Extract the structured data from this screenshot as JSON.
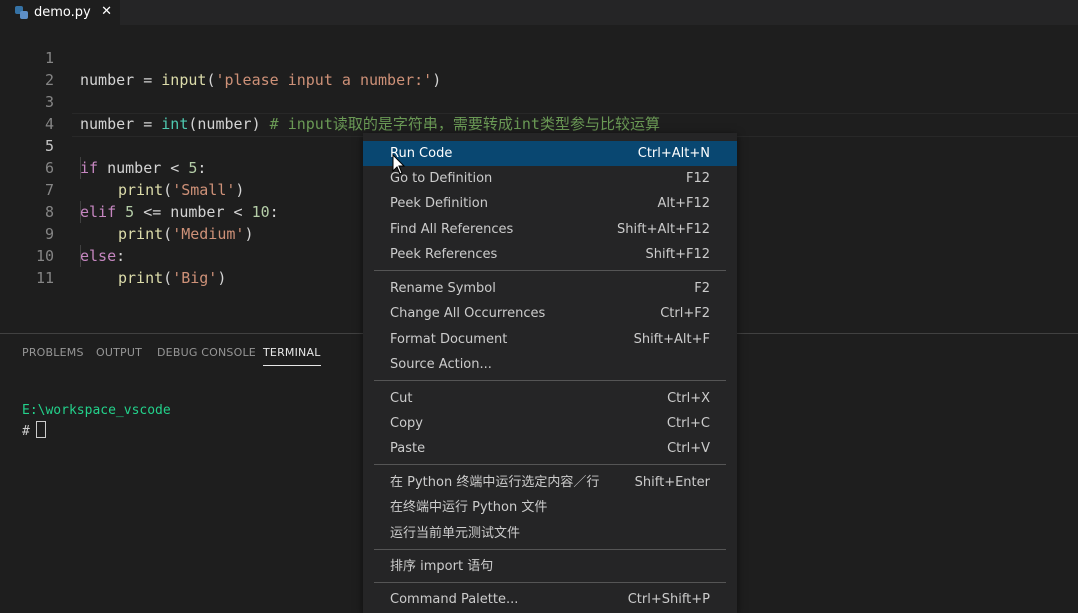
{
  "tab": {
    "label": "demo.py",
    "close": "✕"
  },
  "editor": {
    "line_numbers": [
      "1",
      "2",
      "3",
      "4",
      "5",
      "6",
      "7",
      "8",
      "9",
      "10",
      "11"
    ],
    "line1": {
      "a": "number",
      "b": " = ",
      "c": "input",
      "d": "(",
      "e": "'please input a number:'",
      "f": ")"
    },
    "line3": {
      "a": "number",
      "b": " = ",
      "c": "int",
      "d": "(number) ",
      "e": "# input读取的是字符串，需要转成int类型参与比较运算"
    },
    "line5": {
      "a": "if",
      "b": " number < ",
      "c": "5",
      "d": ":"
    },
    "line6": {
      "a": "print",
      "b": "(",
      "c": "'Small'",
      "d": ")"
    },
    "line7": {
      "a": "elif",
      "b": " ",
      "c": "5",
      "d": " <= number < ",
      "e": "10",
      "f": ":"
    },
    "line8": {
      "a": "print",
      "b": "(",
      "c": "'Medium'",
      "d": ")"
    },
    "line9": {
      "a": "else",
      "b": ":"
    },
    "line10": {
      "a": "print",
      "b": "(",
      "c": "'Big'",
      "d": ")"
    }
  },
  "panel": {
    "tabs": [
      "PROBLEMS",
      "OUTPUT",
      "DEBUG CONSOLE",
      "TERMINAL"
    ],
    "active_tab": "TERMINAL",
    "terminal_path": "E:\\workspace_vscode",
    "terminal_prompt": "#"
  },
  "context_menu": {
    "items": [
      {
        "label": "Run Code",
        "key": "Ctrl+Alt+N"
      },
      {
        "label": "Go to Definition",
        "key": "F12"
      },
      {
        "label": "Peek Definition",
        "key": "Alt+F12"
      },
      {
        "label": "Find All References",
        "key": "Shift+Alt+F12"
      },
      {
        "label": "Peek References",
        "key": "Shift+F12"
      },
      {
        "label": "Rename Symbol",
        "key": "F2"
      },
      {
        "label": "Change All Occurrences",
        "key": "Ctrl+F2"
      },
      {
        "label": "Format Document",
        "key": "Shift+Alt+F"
      },
      {
        "label": "Source Action...",
        "key": ""
      },
      {
        "label": "Cut",
        "key": "Ctrl+X"
      },
      {
        "label": "Copy",
        "key": "Ctrl+C"
      },
      {
        "label": "Paste",
        "key": "Ctrl+V"
      },
      {
        "label": "在 Python 终端中运行选定内容／行",
        "key": "Shift+Enter"
      },
      {
        "label": "在终端中运行 Python 文件",
        "key": ""
      },
      {
        "label": "运行当前单元测试文件",
        "key": ""
      },
      {
        "label": "排序 import 语句",
        "key": ""
      },
      {
        "label": "Command Palette...",
        "key": "Ctrl+Shift+P"
      }
    ],
    "highlighted_item": "Run Code"
  },
  "colors": {
    "editor_bg": "#1e1e1e",
    "menu_bg": "#252526",
    "menu_highlight": "#094771",
    "keyword": "#c586c0",
    "function": "#dcdcaa",
    "string": "#ce9178",
    "comment": "#6a9955",
    "terminal_path": "#23d18b"
  },
  "icons": [
    "python-file-icon",
    "close-icon",
    "mouse-pointer-icon"
  ]
}
